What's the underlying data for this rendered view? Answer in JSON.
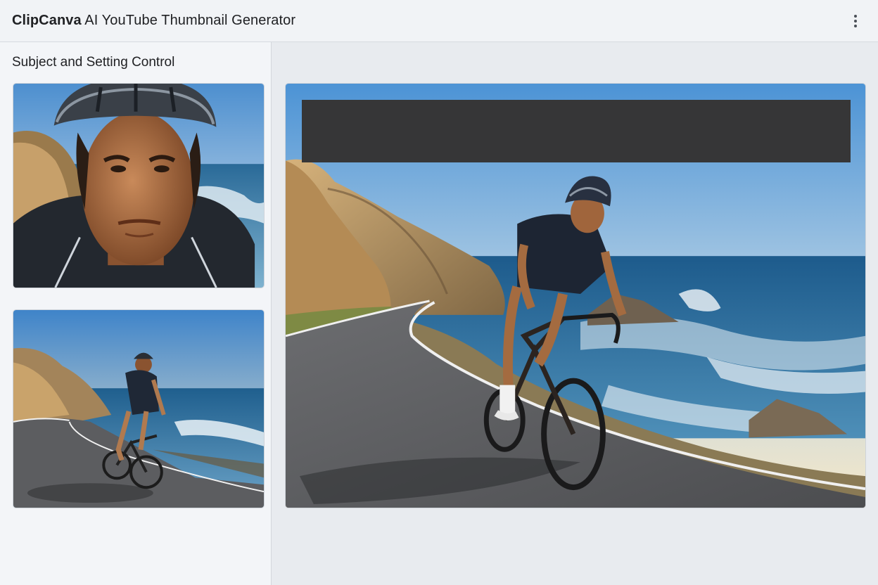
{
  "header": {
    "brand": "ClipCanva",
    "title": "AI YouTube Thumbnail Generator",
    "menu_icon": "more-vertical-icon"
  },
  "sidebar": {
    "title": "Subject and Setting Control",
    "thumbnails": [
      {
        "subject": "cyclist-closeup",
        "selected": false
      },
      {
        "subject": "cyclist-coastal-road",
        "selected": false
      }
    ]
  },
  "preview": {
    "title_text": "",
    "title_bar_color": "#363637"
  },
  "colors": {
    "header_bg": "#f1f3f6",
    "sidebar_bg": "#f3f5f8",
    "workspace_bg": "#e8ebef"
  }
}
